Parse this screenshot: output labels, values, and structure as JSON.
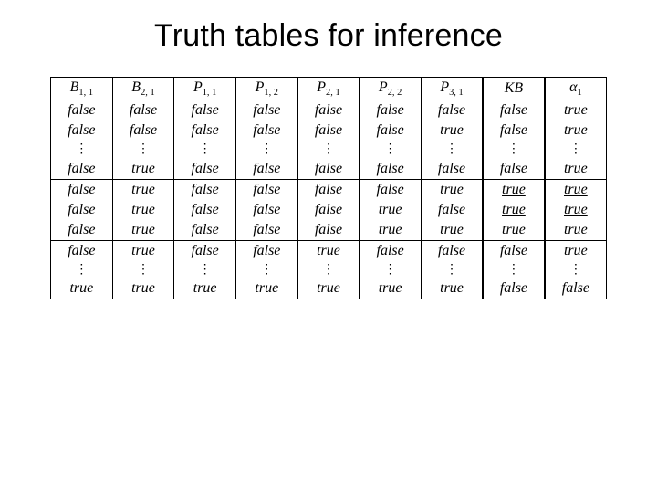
{
  "title": "Truth tables for inference",
  "headers": {
    "b11": "B",
    "b11_sub": "1, 1",
    "b21": "B",
    "b21_sub": "2, 1",
    "p11": "P",
    "p11_sub": "1, 1",
    "p12": "P",
    "p12_sub": "1, 2",
    "p21": "P",
    "p21_sub": "2, 1",
    "p22": "P",
    "p22_sub": "2, 2",
    "p31": "P",
    "p31_sub": "3, 1",
    "kb": "KB",
    "a1": "α",
    "a1_sub": "1"
  },
  "vals": {
    "t": "true",
    "f": "false",
    "d": "⋮"
  },
  "rows": [
    {
      "id": "r1",
      "c": [
        "f",
        "f",
        "f",
        "f",
        "f",
        "f",
        "f",
        "f",
        "t"
      ],
      "sep_top": false,
      "under_kb": false,
      "under_a": false
    },
    {
      "id": "r2",
      "c": [
        "f",
        "f",
        "f",
        "f",
        "f",
        "f",
        "t",
        "f",
        "t"
      ],
      "sep_top": false,
      "under_kb": false,
      "under_a": false
    },
    {
      "id": "r3",
      "c": [
        "d",
        "d",
        "d",
        "d",
        "d",
        "d",
        "d",
        "d",
        "d"
      ],
      "sep_top": false,
      "under_kb": false,
      "under_a": false
    },
    {
      "id": "r4",
      "c": [
        "f",
        "t",
        "f",
        "f",
        "f",
        "f",
        "f",
        "f",
        "t"
      ],
      "sep_top": false,
      "under_kb": false,
      "under_a": false
    },
    {
      "id": "r5",
      "c": [
        "f",
        "t",
        "f",
        "f",
        "f",
        "f",
        "t",
        "t",
        "t"
      ],
      "sep_top": true,
      "under_kb": true,
      "under_a": true
    },
    {
      "id": "r6",
      "c": [
        "f",
        "t",
        "f",
        "f",
        "f",
        "t",
        "f",
        "t",
        "t"
      ],
      "sep_top": false,
      "under_kb": true,
      "under_a": true
    },
    {
      "id": "r7",
      "c": [
        "f",
        "t",
        "f",
        "f",
        "f",
        "t",
        "t",
        "t",
        "t"
      ],
      "sep_top": false,
      "under_kb": true,
      "under_a": true
    },
    {
      "id": "r8",
      "c": [
        "f",
        "t",
        "f",
        "f",
        "t",
        "f",
        "f",
        "f",
        "t"
      ],
      "sep_top": true,
      "under_kb": false,
      "under_a": false
    },
    {
      "id": "r9",
      "c": [
        "d",
        "d",
        "d",
        "d",
        "d",
        "d",
        "d",
        "d",
        "d"
      ],
      "sep_top": false,
      "under_kb": false,
      "under_a": false
    },
    {
      "id": "r10",
      "c": [
        "t",
        "t",
        "t",
        "t",
        "t",
        "t",
        "t",
        "f",
        "f"
      ],
      "sep_top": false,
      "under_kb": false,
      "under_a": false
    }
  ]
}
